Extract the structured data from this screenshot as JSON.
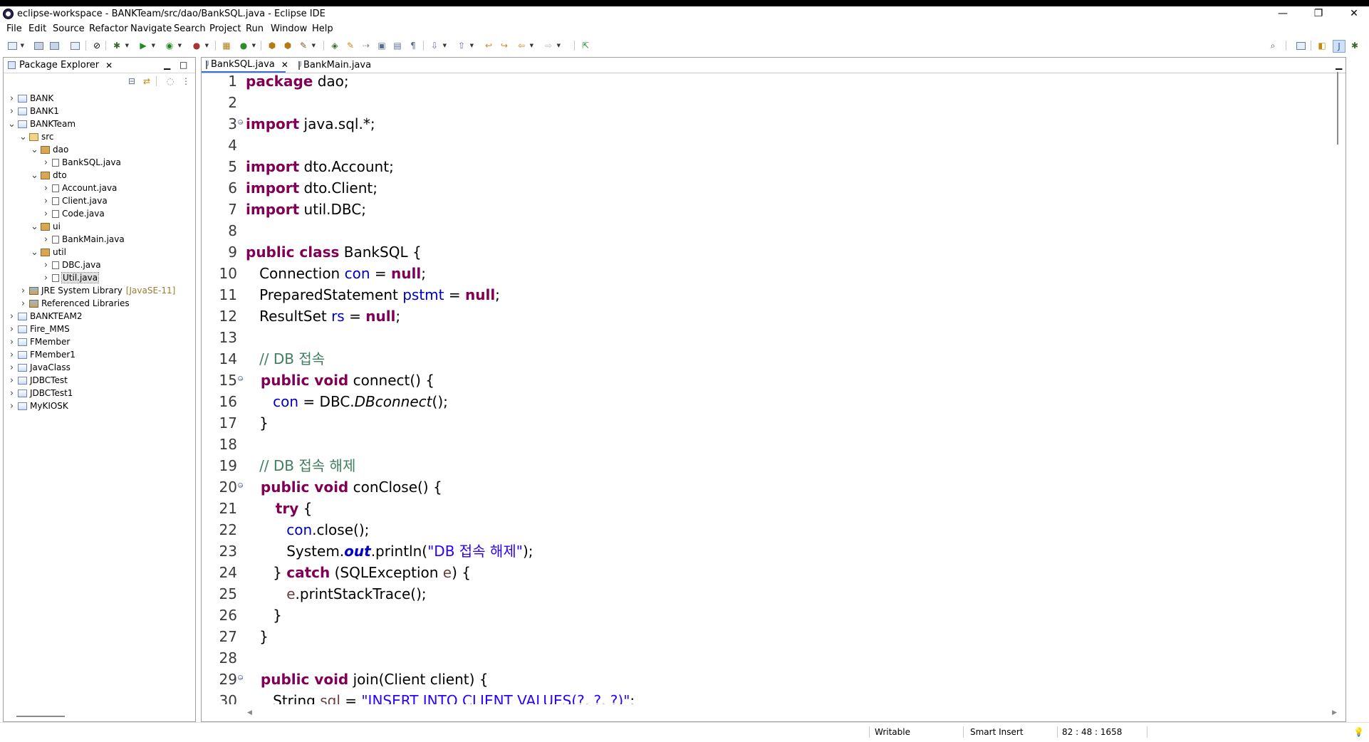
{
  "window": {
    "title": "eclipse-workspace - BANKTeam/src/dao/BankSQL.java - Eclipse IDE",
    "minimize": "—",
    "maximize": "❐",
    "close": "✕"
  },
  "menu": [
    "File",
    "Edit",
    "Source",
    "Refactor",
    "Navigate",
    "Search",
    "Project",
    "Run",
    "Window",
    "Help"
  ],
  "package_explorer": {
    "title": "Package Explorer",
    "tree": [
      {
        "label": "BANK",
        "level": 0,
        "toggle": ">",
        "icon": "project"
      },
      {
        "label": "BANK1",
        "level": 0,
        "toggle": ">",
        "icon": "project"
      },
      {
        "label": "BANKTeam",
        "level": 0,
        "toggle": "v",
        "icon": "project"
      },
      {
        "label": "src",
        "level": 1,
        "toggle": "v",
        "icon": "source-folder"
      },
      {
        "label": "dao",
        "level": 2,
        "toggle": "v",
        "icon": "package"
      },
      {
        "label": "BankSQL.java",
        "level": 3,
        "toggle": ">",
        "icon": "java-file"
      },
      {
        "label": "dto",
        "level": 2,
        "toggle": "v",
        "icon": "package"
      },
      {
        "label": "Account.java",
        "level": 3,
        "toggle": ">",
        "icon": "java-file"
      },
      {
        "label": "Client.java",
        "level": 3,
        "toggle": ">",
        "icon": "java-file"
      },
      {
        "label": "Code.java",
        "level": 3,
        "toggle": ">",
        "icon": "java-file"
      },
      {
        "label": "ui",
        "level": 2,
        "toggle": "v",
        "icon": "package"
      },
      {
        "label": "BankMain.java",
        "level": 3,
        "toggle": ">",
        "icon": "java-file"
      },
      {
        "label": "util",
        "level": 2,
        "toggle": "v",
        "icon": "package"
      },
      {
        "label": "DBC.java",
        "level": 3,
        "toggle": ">",
        "icon": "java-file"
      },
      {
        "label": "Util.java",
        "level": 3,
        "toggle": ">",
        "icon": "java-file",
        "selected": true
      },
      {
        "label": "JRE System Library",
        "level": 1,
        "toggle": ">",
        "icon": "library",
        "decoration": "[JavaSE-11]"
      },
      {
        "label": "Referenced Libraries",
        "level": 1,
        "toggle": ">",
        "icon": "library"
      },
      {
        "label": "BANKTEAM2",
        "level": 0,
        "toggle": ">",
        "icon": "project"
      },
      {
        "label": "Fire_MMS",
        "level": 0,
        "toggle": ">",
        "icon": "project"
      },
      {
        "label": "FMember",
        "level": 0,
        "toggle": ">",
        "icon": "project"
      },
      {
        "label": "FMember1",
        "level": 0,
        "toggle": ">",
        "icon": "project"
      },
      {
        "label": "JavaClass",
        "level": 0,
        "toggle": ">",
        "icon": "project"
      },
      {
        "label": "JDBCTest",
        "level": 0,
        "toggle": ">",
        "icon": "project"
      },
      {
        "label": "JDBCTest1",
        "level": 0,
        "toggle": ">",
        "icon": "project"
      },
      {
        "label": "MyKIOSK",
        "level": 0,
        "toggle": ">",
        "icon": "project"
      }
    ]
  },
  "editor": {
    "tabs": [
      {
        "label": "BankSQL.java",
        "active": true
      },
      {
        "label": "BankMain.java",
        "active": false
      }
    ],
    "lines": [
      {
        "n": "1",
        "fold": false,
        "tokens": [
          [
            "kw",
            "package"
          ],
          [
            "",
            "dao;"
          ]
        ]
      },
      {
        "n": "2",
        "fold": false,
        "tokens": []
      },
      {
        "n": "3",
        "fold": true,
        "tokens": [
          [
            "kw",
            "import"
          ],
          [
            "",
            "java.sql.*;"
          ]
        ]
      },
      {
        "n": "4",
        "fold": false,
        "tokens": []
      },
      {
        "n": "5",
        "fold": false,
        "tokens": [
          [
            "kw",
            "import"
          ],
          [
            "",
            "dto.Account;"
          ]
        ]
      },
      {
        "n": "6",
        "fold": false,
        "tokens": [
          [
            "kw",
            "import"
          ],
          [
            "",
            "dto.Client;"
          ]
        ]
      },
      {
        "n": "7",
        "fold": false,
        "tokens": [
          [
            "kw",
            "import"
          ],
          [
            "",
            "util.DBC;"
          ]
        ]
      },
      {
        "n": "8",
        "fold": false,
        "tokens": []
      },
      {
        "n": "9",
        "fold": false,
        "tokens": [
          [
            "kw",
            "public class"
          ],
          [
            "",
            "BankSQL {"
          ]
        ]
      },
      {
        "n": "10",
        "fold": false,
        "tokens": [
          [
            "",
            "   Connection "
          ],
          [
            "fld",
            "con"
          ],
          [
            "",
            " = "
          ],
          [
            "kw",
            "null"
          ],
          [
            "",
            ";"
          ]
        ]
      },
      {
        "n": "11",
        "fold": false,
        "tokens": [
          [
            "",
            "   PreparedStatement "
          ],
          [
            "fld",
            "pstmt"
          ],
          [
            "",
            " = "
          ],
          [
            "kw",
            "null"
          ],
          [
            "",
            ";"
          ]
        ]
      },
      {
        "n": "12",
        "fold": false,
        "tokens": [
          [
            "",
            "   ResultSet "
          ],
          [
            "fld",
            "rs"
          ],
          [
            "",
            " = "
          ],
          [
            "kw",
            "null"
          ],
          [
            "",
            ";"
          ]
        ]
      },
      {
        "n": "13",
        "fold": false,
        "tokens": []
      },
      {
        "n": "14",
        "fold": false,
        "tokens": [
          [
            "cmt",
            "   // DB 접속"
          ]
        ]
      },
      {
        "n": "15",
        "fold": true,
        "tokens": [
          [
            "kw",
            "   public void"
          ],
          [
            "",
            " connect() {"
          ]
        ]
      },
      {
        "n": "16",
        "fold": false,
        "tokens": [
          [
            "",
            "      "
          ],
          [
            "fld",
            "con"
          ],
          [
            "",
            " = DBC."
          ],
          [
            "it",
            "DBconnect"
          ],
          [
            "",
            "();"
          ]
        ]
      },
      {
        "n": "17",
        "fold": false,
        "tokens": [
          [
            "",
            "   }"
          ]
        ]
      },
      {
        "n": "18",
        "fold": false,
        "tokens": []
      },
      {
        "n": "19",
        "fold": false,
        "tokens": [
          [
            "cmt",
            "   // DB 접속 해제"
          ]
        ]
      },
      {
        "n": "20",
        "fold": true,
        "tokens": [
          [
            "kw",
            "   public void"
          ],
          [
            "",
            " conClose() {"
          ]
        ]
      },
      {
        "n": "21",
        "fold": false,
        "tokens": [
          [
            "kw",
            "      try"
          ],
          [
            "",
            " {"
          ]
        ]
      },
      {
        "n": "22",
        "fold": false,
        "tokens": [
          [
            "",
            "         "
          ],
          [
            "fld",
            "con"
          ],
          [
            "",
            ".close();"
          ]
        ]
      },
      {
        "n": "23",
        "fold": false,
        "tokens": [
          [
            "",
            "         System."
          ],
          [
            "sfld",
            "out"
          ],
          [
            "",
            ".println("
          ],
          [
            "str",
            "\"DB 접속 해제\""
          ],
          [
            "",
            ");"
          ]
        ]
      },
      {
        "n": "24",
        "fold": false,
        "tokens": [
          [
            "",
            "      } "
          ],
          [
            "kw",
            "catch"
          ],
          [
            "",
            " (SQLException "
          ],
          [
            "var",
            "e"
          ],
          [
            "",
            ") {"
          ]
        ]
      },
      {
        "n": "25",
        "fold": false,
        "tokens": [
          [
            "",
            "         "
          ],
          [
            "var",
            "e"
          ],
          [
            "",
            ".printStackTrace();"
          ]
        ]
      },
      {
        "n": "26",
        "fold": false,
        "tokens": [
          [
            "",
            "      }"
          ]
        ]
      },
      {
        "n": "27",
        "fold": false,
        "tokens": [
          [
            "",
            "   }"
          ]
        ]
      },
      {
        "n": "28",
        "fold": false,
        "tokens": []
      },
      {
        "n": "29",
        "fold": true,
        "tokens": [
          [
            "kw",
            "   public void"
          ],
          [
            "",
            " join(Client client) {"
          ]
        ]
      },
      {
        "n": "30",
        "fold": false,
        "tokens": [
          [
            "",
            "      String "
          ],
          [
            "var",
            "sql"
          ],
          [
            "",
            " = "
          ],
          [
            "str",
            "\"INSERT INTO CLIENT VALUES(?, ?, ?)\""
          ],
          [
            "",
            ";"
          ]
        ]
      }
    ]
  },
  "status": {
    "writable": "Writable",
    "insert_mode": "Smart Insert",
    "position": "82 : 48 : 1658"
  },
  "colors": {
    "keyword": "#7f0055",
    "field": "#0000c0",
    "comment": "#3f7f5f",
    "string": "#2a00ff",
    "active_tab_accent": "#3b6fd6"
  }
}
